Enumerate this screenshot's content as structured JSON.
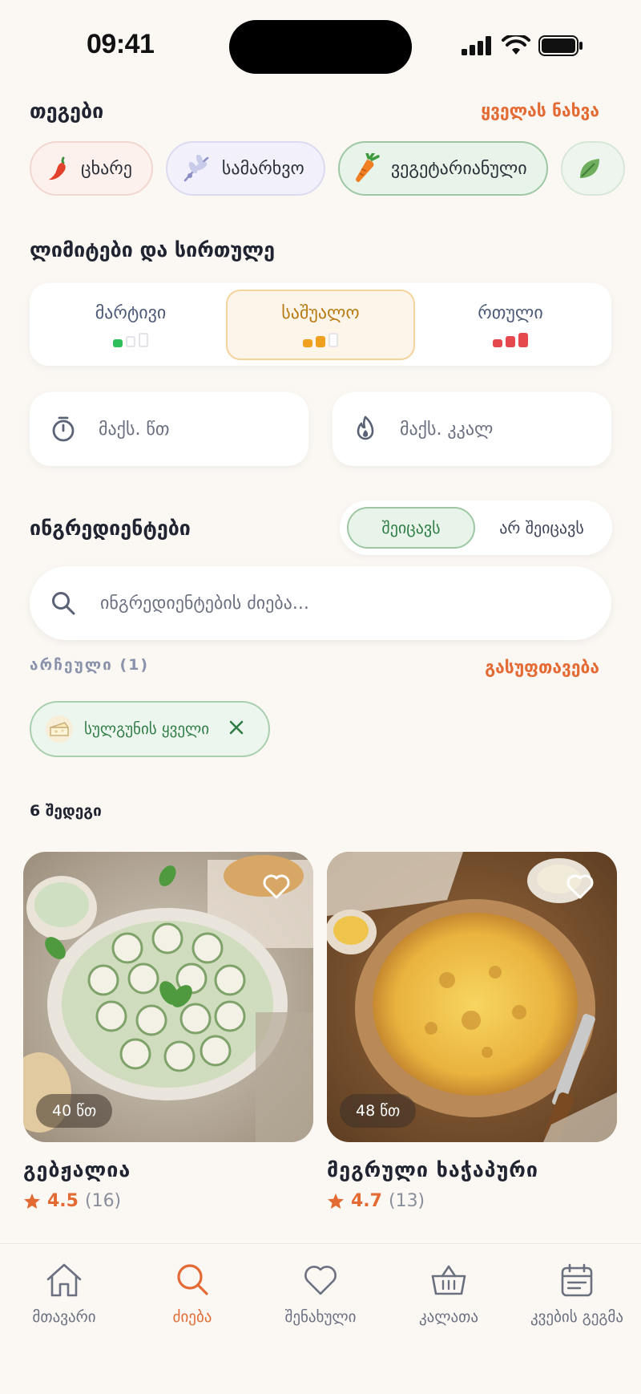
{
  "status": {
    "time": "09:41"
  },
  "tags_section": {
    "title": "თეგები",
    "see_all": "ყველას ნახვა",
    "items": [
      {
        "label": "ცხარე",
        "icon": "chili-pepper-icon"
      },
      {
        "label": "სამარხვო",
        "icon": "olive-branch-icon"
      },
      {
        "label": "ვეგეტარიანული",
        "icon": "carrot-icon"
      },
      {
        "label": "",
        "icon": "leaf-icon"
      }
    ]
  },
  "limits_section": {
    "title": "ლიმიტები და სირთულე",
    "difficulty": [
      {
        "label": "მარტივი",
        "level": 1,
        "selected": false,
        "color": "#2fbf5a"
      },
      {
        "label": "საშუალო",
        "level": 2,
        "selected": true,
        "color": "#f0a01f"
      },
      {
        "label": "რთული",
        "level": 3,
        "selected": false,
        "color": "#e5484d"
      }
    ],
    "max_time_placeholder": "მაქს. წთ",
    "max_kcal_placeholder": "მაქს. კკალ"
  },
  "ingredients_section": {
    "title": "ინგრედიენტები",
    "toggle_include": "შეიცავს",
    "toggle_exclude": "არ შეიცავს",
    "search_placeholder": "ინგრედიენტების ძიება...",
    "selected_label": "არჩეული (1)",
    "clear": "გასუფთავება",
    "selected": [
      {
        "label": "სულგუნის ყველი",
        "icon": "cheese-icon"
      }
    ]
  },
  "results": {
    "count_label": "6 შედეგი",
    "cards": [
      {
        "name": "გებჟალია",
        "time": "40 წთ",
        "rating": "4.5",
        "reviews": "(16)"
      },
      {
        "name": "მეგრული ხაჭაპური",
        "time": "48 წთ",
        "rating": "4.7",
        "reviews": "(13)"
      }
    ]
  },
  "nav": {
    "items": [
      {
        "label": "მთავარი",
        "icon": "home-icon",
        "active": false
      },
      {
        "label": "ძიება",
        "icon": "search-icon",
        "active": true
      },
      {
        "label": "შენახული",
        "icon": "heart-icon",
        "active": false
      },
      {
        "label": "კალათა",
        "icon": "basket-icon",
        "active": false
      },
      {
        "label": "კვების გეგმა",
        "icon": "calendar-icon",
        "active": false
      }
    ]
  },
  "colors": {
    "accent": "#e46a34",
    "green": "#2e7d44",
    "background": "#fbf8f4"
  }
}
